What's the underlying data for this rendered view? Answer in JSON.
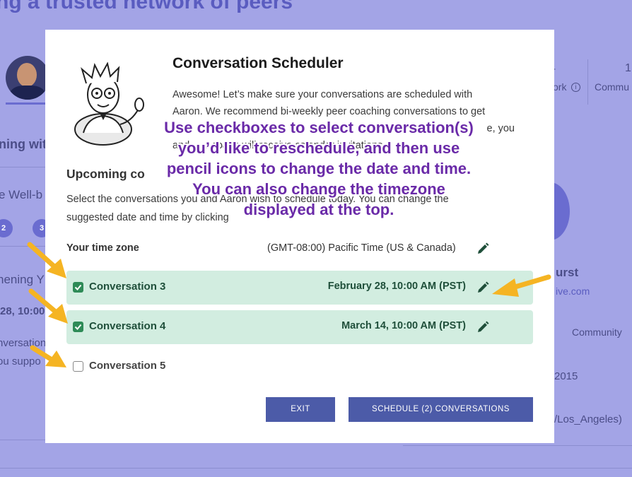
{
  "background": {
    "title": "ng a trusted network of peers",
    "left_heading": "ning wit",
    "left_sub": "e Well-b",
    "pill_1": "2",
    "pill_2": "3",
    "left_event": "nening Y",
    "left_date": "28, 10:00",
    "left_desc_1": "nversation",
    "left_desc_2": "ou suppo",
    "stat_number_1": "4",
    "stat_label_1": "ork",
    "stat_number_2": "1",
    "stat_label_2": "Commu",
    "right_name": "urst",
    "right_email": "ive.com",
    "right_tab": "Community",
    "right_year": "2015",
    "right_tz": "/Los_Angeles)"
  },
  "modal": {
    "title": "Conversation Scheduler",
    "intro_line_1": "Awesome! Let’s make sure your conversations are scheduled with",
    "intro_line_2": "Aaron. We recommend bi-weekly peer coaching conversations to get",
    "intro_line_3_tail": "e, you",
    "intro_line_4": "and … r coach will receive calendar invitations.",
    "section_title": "Upcoming co",
    "section_desc_1": "Select the conversations you and Aaron wish to schedule today. You can change the",
    "section_desc_2": "suggested date and time by clicking",
    "timezone_label": "Your time zone",
    "timezone_value": "(GMT-08:00) Pacific Time (US & Canada)",
    "conversations": [
      {
        "name": "Conversation 3",
        "date": "February 28, 10:00 AM (PST)",
        "checked": true
      },
      {
        "name": "Conversation 4",
        "date": "March 14, 10:00 AM (PST)",
        "checked": true
      },
      {
        "name": "Conversation 5",
        "date": "",
        "checked": false
      }
    ],
    "exit_label": "EXIT",
    "schedule_label": "SCHEDULE (2) CONVERSATIONS"
  },
  "annotation": {
    "line_1": "Use checkboxes to select conversation(s)",
    "line_2": "you’d like to reschedule, and then use",
    "line_3": "pencil icons to change the date and time.",
    "line_4": "You can also change the timezone",
    "line_5": "displayed at the top."
  },
  "colors": {
    "overlay": "#a3a4e6",
    "selected_row": "#d2ede0",
    "checkbox": "#2e8b57",
    "button": "#4c5ba8",
    "annotation_text": "#6a2aa8",
    "arrow": "#f5b423"
  },
  "icons": {
    "pencil": "pencil-icon",
    "check": "check-icon",
    "arrow": "arrow-icon",
    "info": "info-icon"
  }
}
